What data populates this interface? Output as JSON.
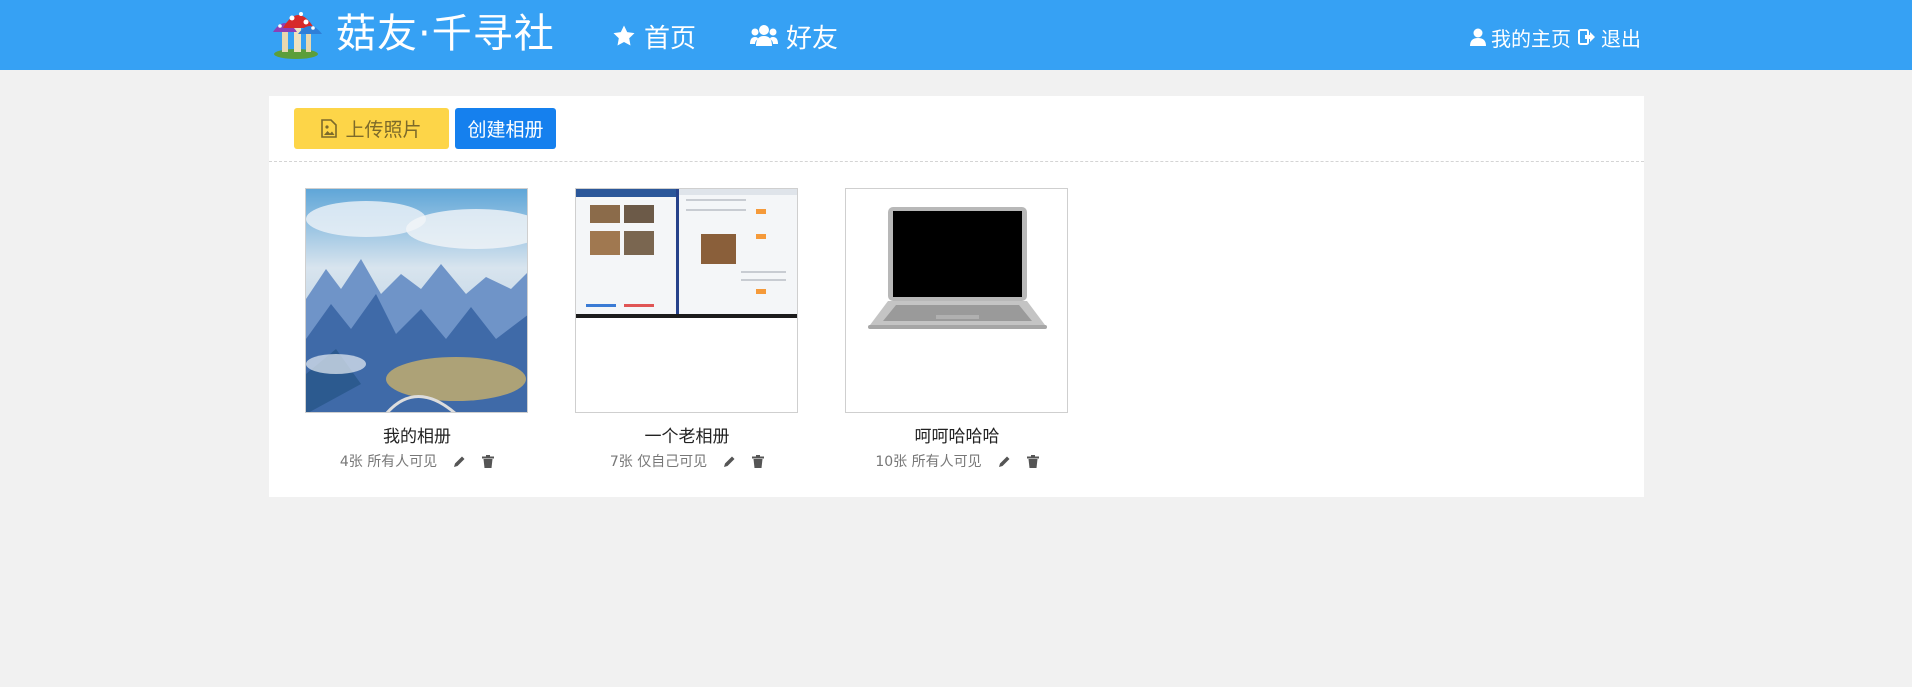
{
  "navbar": {
    "brand": "菇友·千寻社",
    "home_label": "首页",
    "friends_label": "好友",
    "profile_label": "我的主页",
    "logout_label": "退出"
  },
  "toolbar": {
    "upload_label": "上传照片",
    "create_label": "创建相册"
  },
  "albums": [
    {
      "name": "我的相册",
      "count": "4张",
      "visibility": "所有人可见",
      "cover": "landscape-photo"
    },
    {
      "name": "一个老相册",
      "count": "7张",
      "visibility": "仅自己可见",
      "cover": "screenshot"
    },
    {
      "name": "呵呵哈哈哈",
      "count": "10张",
      "visibility": "所有人可见",
      "cover": "laptop-photo"
    }
  ],
  "colors": {
    "navbar": "#36a1f4",
    "upload_button": "#fdd548",
    "create_button": "#1580ee",
    "page_background": "#f1f1f1"
  }
}
